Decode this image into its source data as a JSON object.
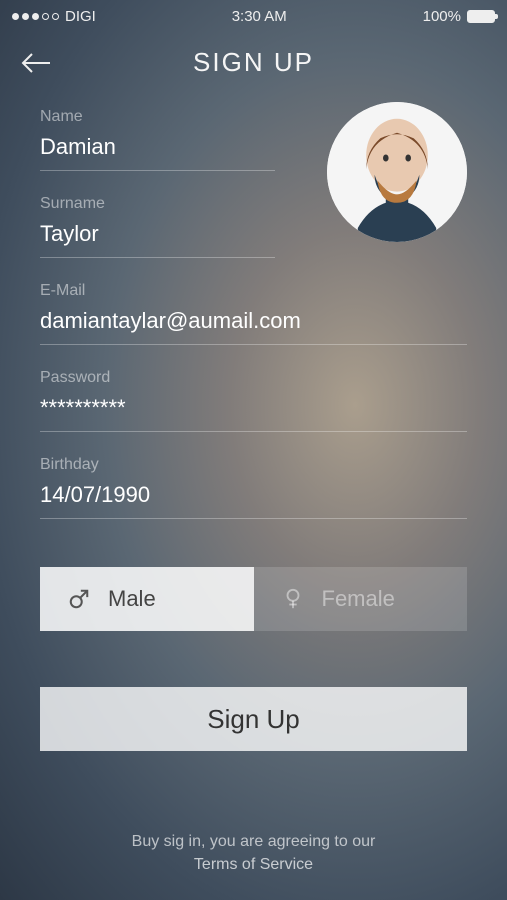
{
  "status": {
    "carrier": "DIGI",
    "time": "3:30 AM",
    "battery": "100%"
  },
  "nav": {
    "title": "SIGN UP"
  },
  "form": {
    "name_label": "Name",
    "name_value": "Damian",
    "surname_label": "Surname",
    "surname_value": "Taylor",
    "email_label": "E-Mail",
    "email_value": "damiantaylar@aumail.com",
    "password_label": "Password",
    "password_value": "**********",
    "birthday_label": "Birthday",
    "birthday_value": "14/07/1990"
  },
  "gender": {
    "male": "Male",
    "female": "Female",
    "selected": "male"
  },
  "button": {
    "signup": "Sign Up"
  },
  "terms": {
    "line1": "Buy sig in, you are agreeing to our",
    "line2": "Terms of Service"
  }
}
